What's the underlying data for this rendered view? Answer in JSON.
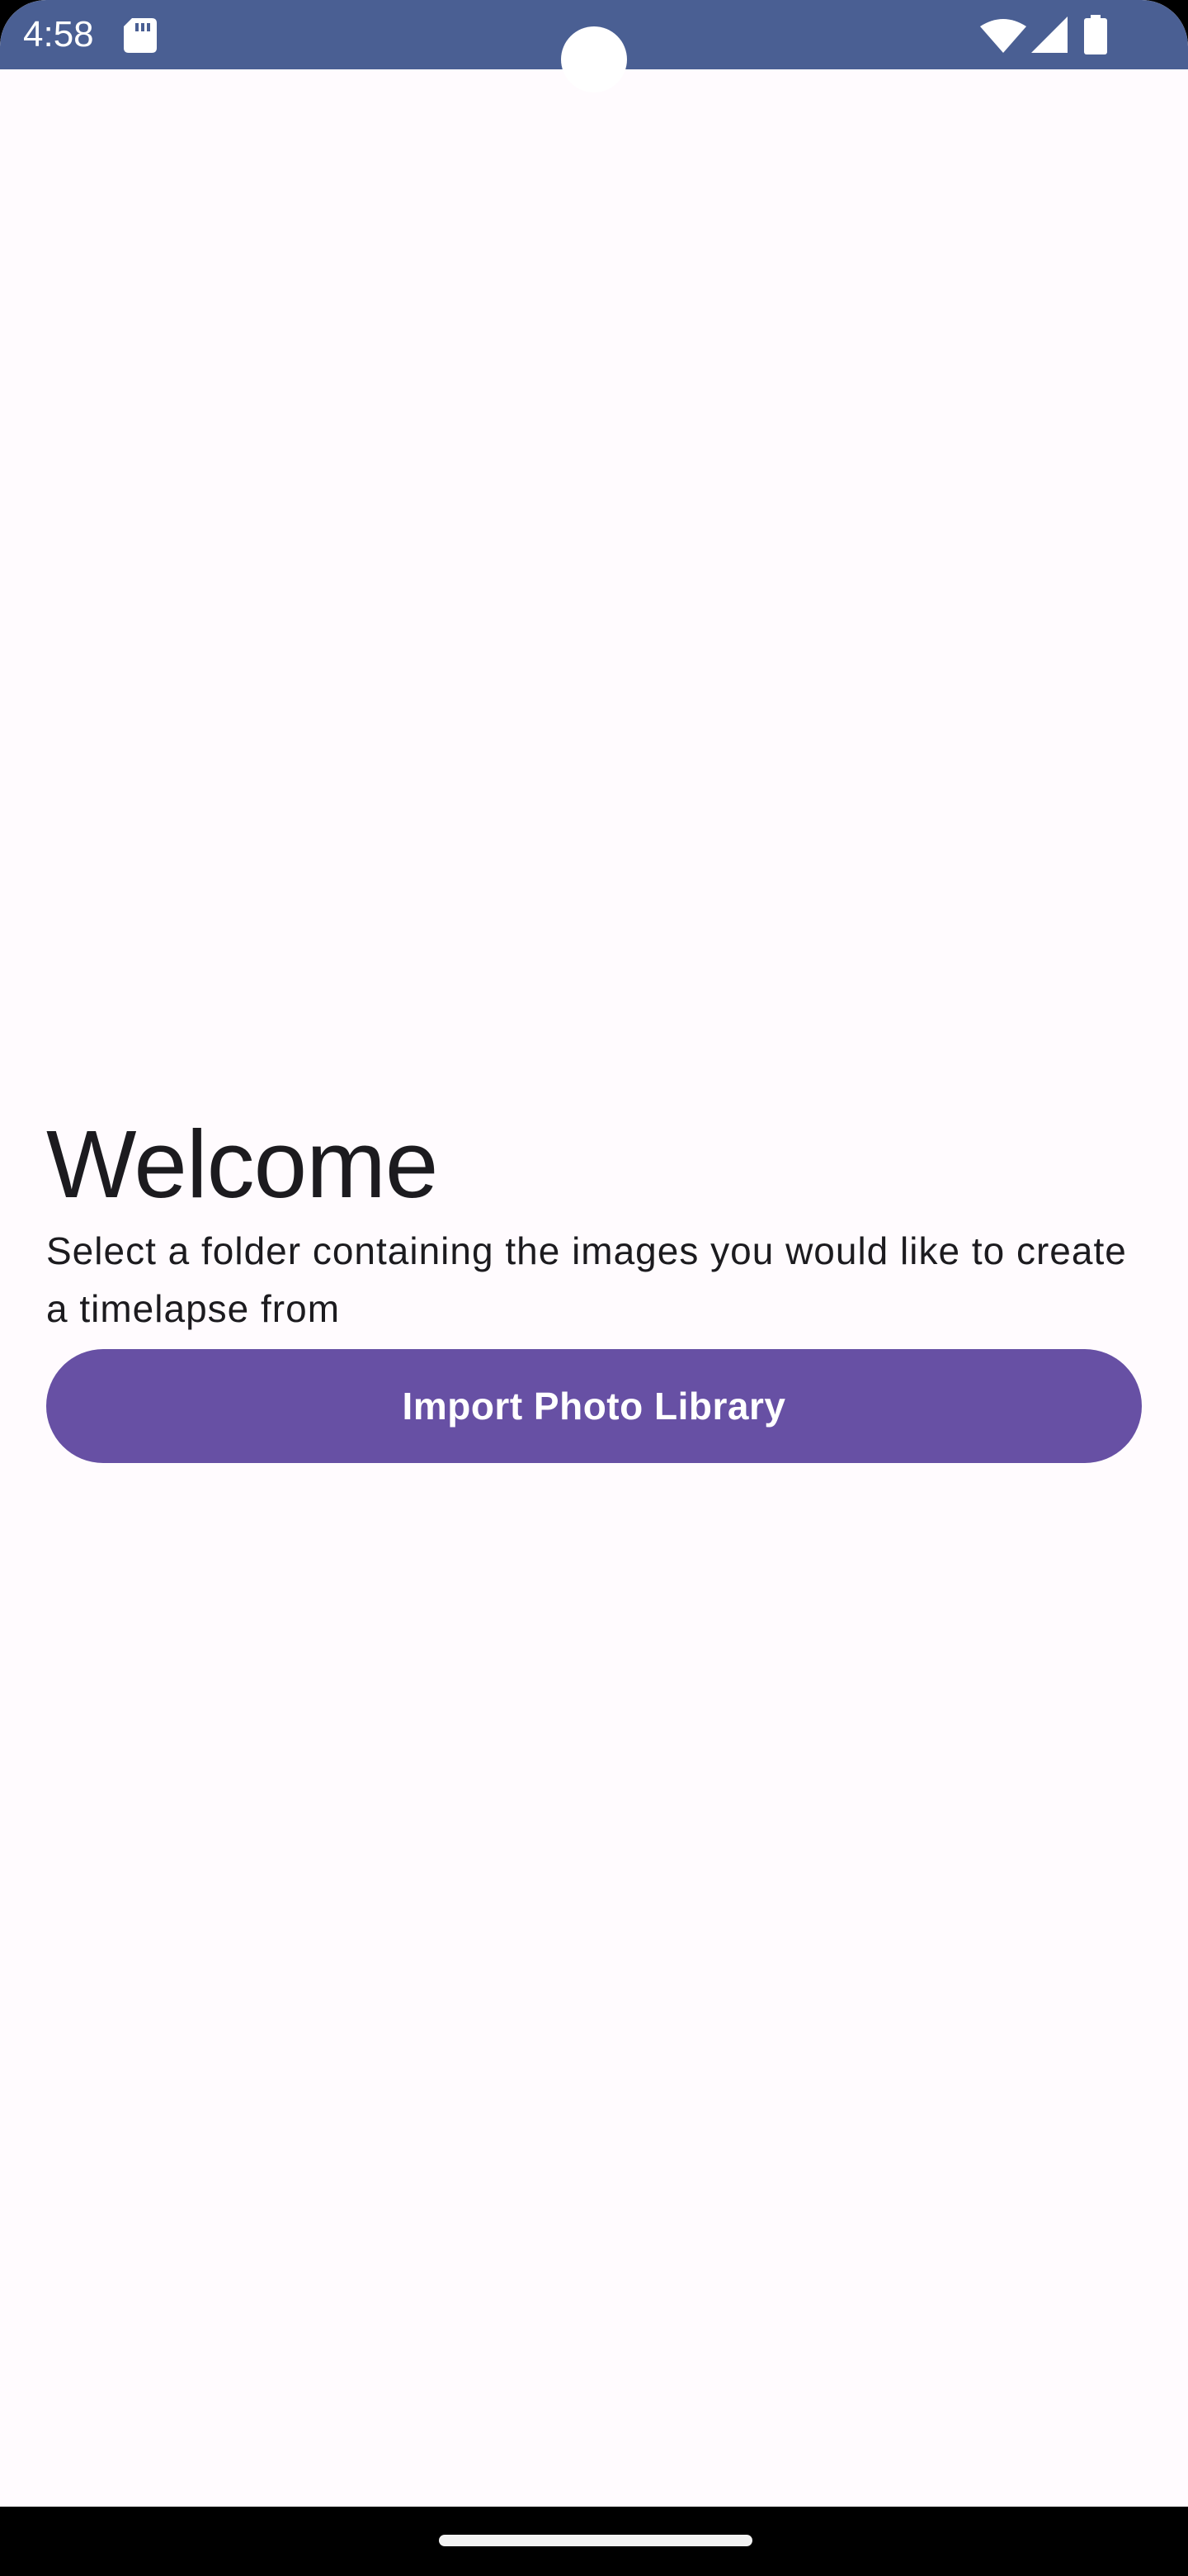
{
  "status_bar": {
    "time": "4:58",
    "icons": [
      "sd-card-icon",
      "wifi-icon",
      "signal-icon",
      "battery-icon"
    ],
    "background_color": "#4a5f93"
  },
  "main": {
    "title": "Welcome",
    "subtitle": "Select a folder containing the images you would like to create a timelapse from",
    "import_button_label": "Import Photo Library",
    "accent_color": "#6750a4",
    "background_color": "#fffbfe"
  },
  "nav_bar": {
    "handle": "home-handle"
  }
}
